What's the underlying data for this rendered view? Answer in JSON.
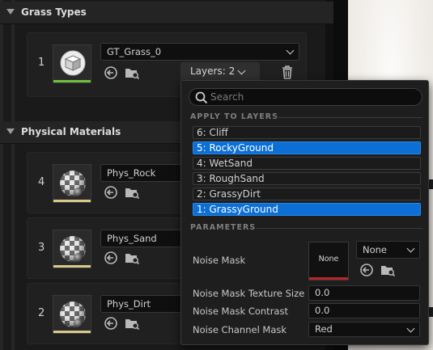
{
  "details": {
    "grass_section": {
      "title": "Grass Types"
    },
    "grass_entry": {
      "index": "1",
      "asset_name": "GT_Grass_0",
      "layers_label": "Layers: 2"
    },
    "physical_section": {
      "title": "Physical Materials"
    },
    "phys_entries": [
      {
        "index": "4",
        "asset_name": "Phys_Rock"
      },
      {
        "index": "3",
        "asset_name": "Phys_Sand"
      },
      {
        "index": "2",
        "asset_name": "Phys_Dirt"
      }
    ]
  },
  "popup": {
    "search": {
      "placeholder": "Search"
    },
    "apply_section": "APPLY TO LAYERS",
    "layers": [
      {
        "label": "6: Cliff",
        "selected": false
      },
      {
        "label": "5: RockyGround",
        "selected": true
      },
      {
        "label": "4: WetSand",
        "selected": false
      },
      {
        "label": "3: RoughSand",
        "selected": false
      },
      {
        "label": "2: GrassyDirt",
        "selected": false
      },
      {
        "label": "1: GrassyGround",
        "selected": true
      }
    ],
    "parameters_section": "PARAMETERS",
    "params": {
      "noise_mask": {
        "label": "Noise Mask",
        "slot_text": "None",
        "dropdown": "None"
      },
      "texture_size": {
        "label": "Noise Mask Texture Size",
        "value": "0.0"
      },
      "contrast": {
        "label": "Noise Mask Contrast",
        "value": "0.0"
      },
      "channel": {
        "label": "Noise Channel Mask",
        "value": "Red"
      }
    }
  },
  "colors": {
    "selected_row": "#0b6fd6",
    "grass_thumb_bar": "#6fbf3f",
    "phys_thumb_bar": "#d9c98a",
    "none_slot_bar": "#b52626"
  },
  "icons": [
    "chevron-down-icon",
    "use-selected-icon",
    "browse-icon",
    "trash-icon",
    "search-icon",
    "cube-thumbnail-icon",
    "checker-sphere-icon"
  ]
}
